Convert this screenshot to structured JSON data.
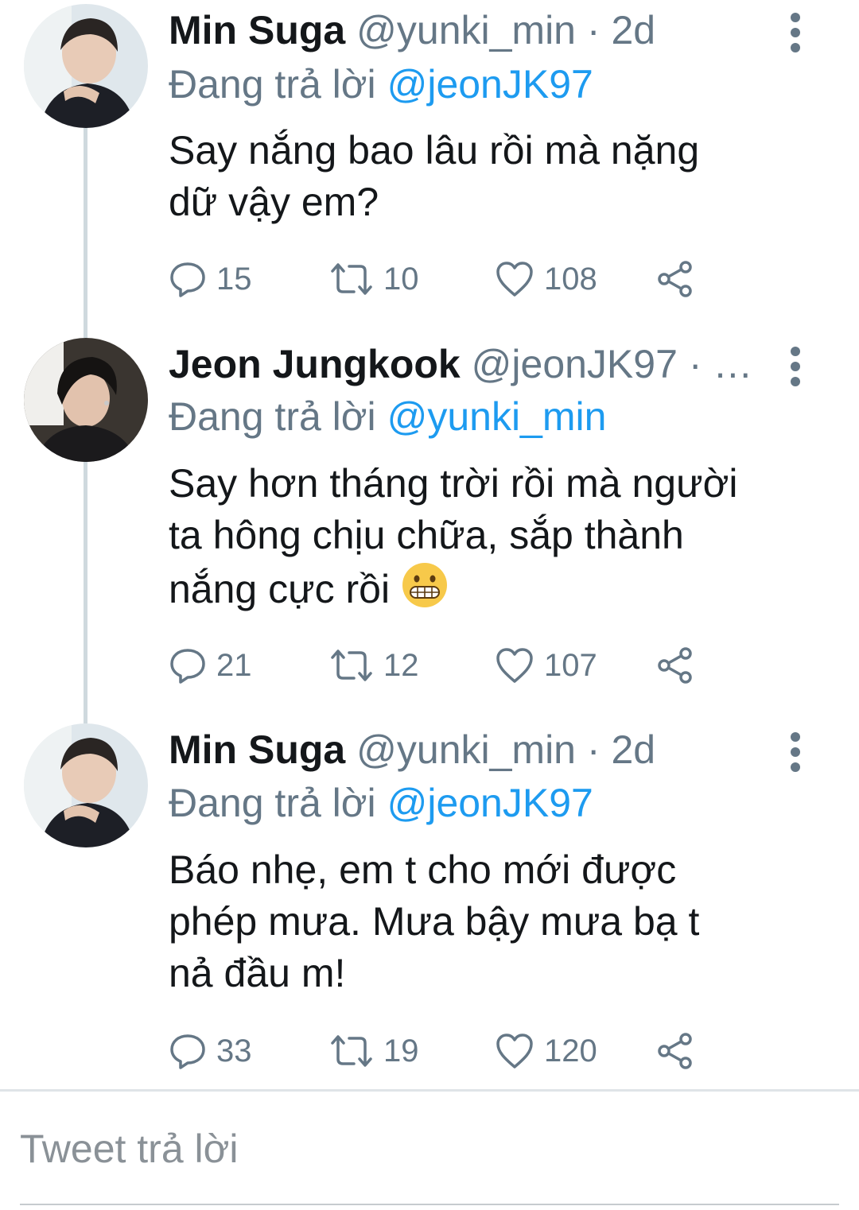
{
  "tweets": [
    {
      "name": "Min Suga",
      "handle": "@yunki_min",
      "separator": "·",
      "time": "2d",
      "reply_prefix": "Đang trả lời",
      "reply_to": "@jeonJK97",
      "text_lines": [
        "Say nắng bao lâu rồi mà nặng",
        "dữ vậy em?"
      ],
      "replies": "15",
      "retweets": "10",
      "likes": "108"
    },
    {
      "name": "Jeon Jungkook",
      "handle": "@jeonJK97",
      "separator": "·",
      "time": "…",
      "reply_prefix": "Đang trả lời",
      "reply_to": "@yunki_min",
      "text_lines": [
        "Say hơn tháng trời rồi mà người",
        "ta hông chịu chữa, sắp thành",
        "nắng cực rồi"
      ],
      "emoji": "grimacing-face",
      "replies": "21",
      "retweets": "12",
      "likes": "107"
    },
    {
      "name": "Min Suga",
      "handle": "@yunki_min",
      "separator": "·",
      "time": "2d",
      "reply_prefix": "Đang trả lời",
      "reply_to": "@jeonJK97",
      "text_lines": [
        "Báo nhẹ, em t cho mới được",
        "phép mưa. Mưa bậy mưa bạ t",
        "nả đầu m!"
      ],
      "replies": "33",
      "retweets": "19",
      "likes": "120"
    }
  ],
  "reply_box": {
    "placeholder": "Tweet trả lời"
  },
  "colors": {
    "accent": "#1d9bf0",
    "muted": "#657786",
    "text": "#14171a",
    "thread_line": "#cfd9de"
  },
  "icons": [
    "reply-icon",
    "retweet-icon",
    "like-icon",
    "share-icon",
    "more-options-icon"
  ]
}
